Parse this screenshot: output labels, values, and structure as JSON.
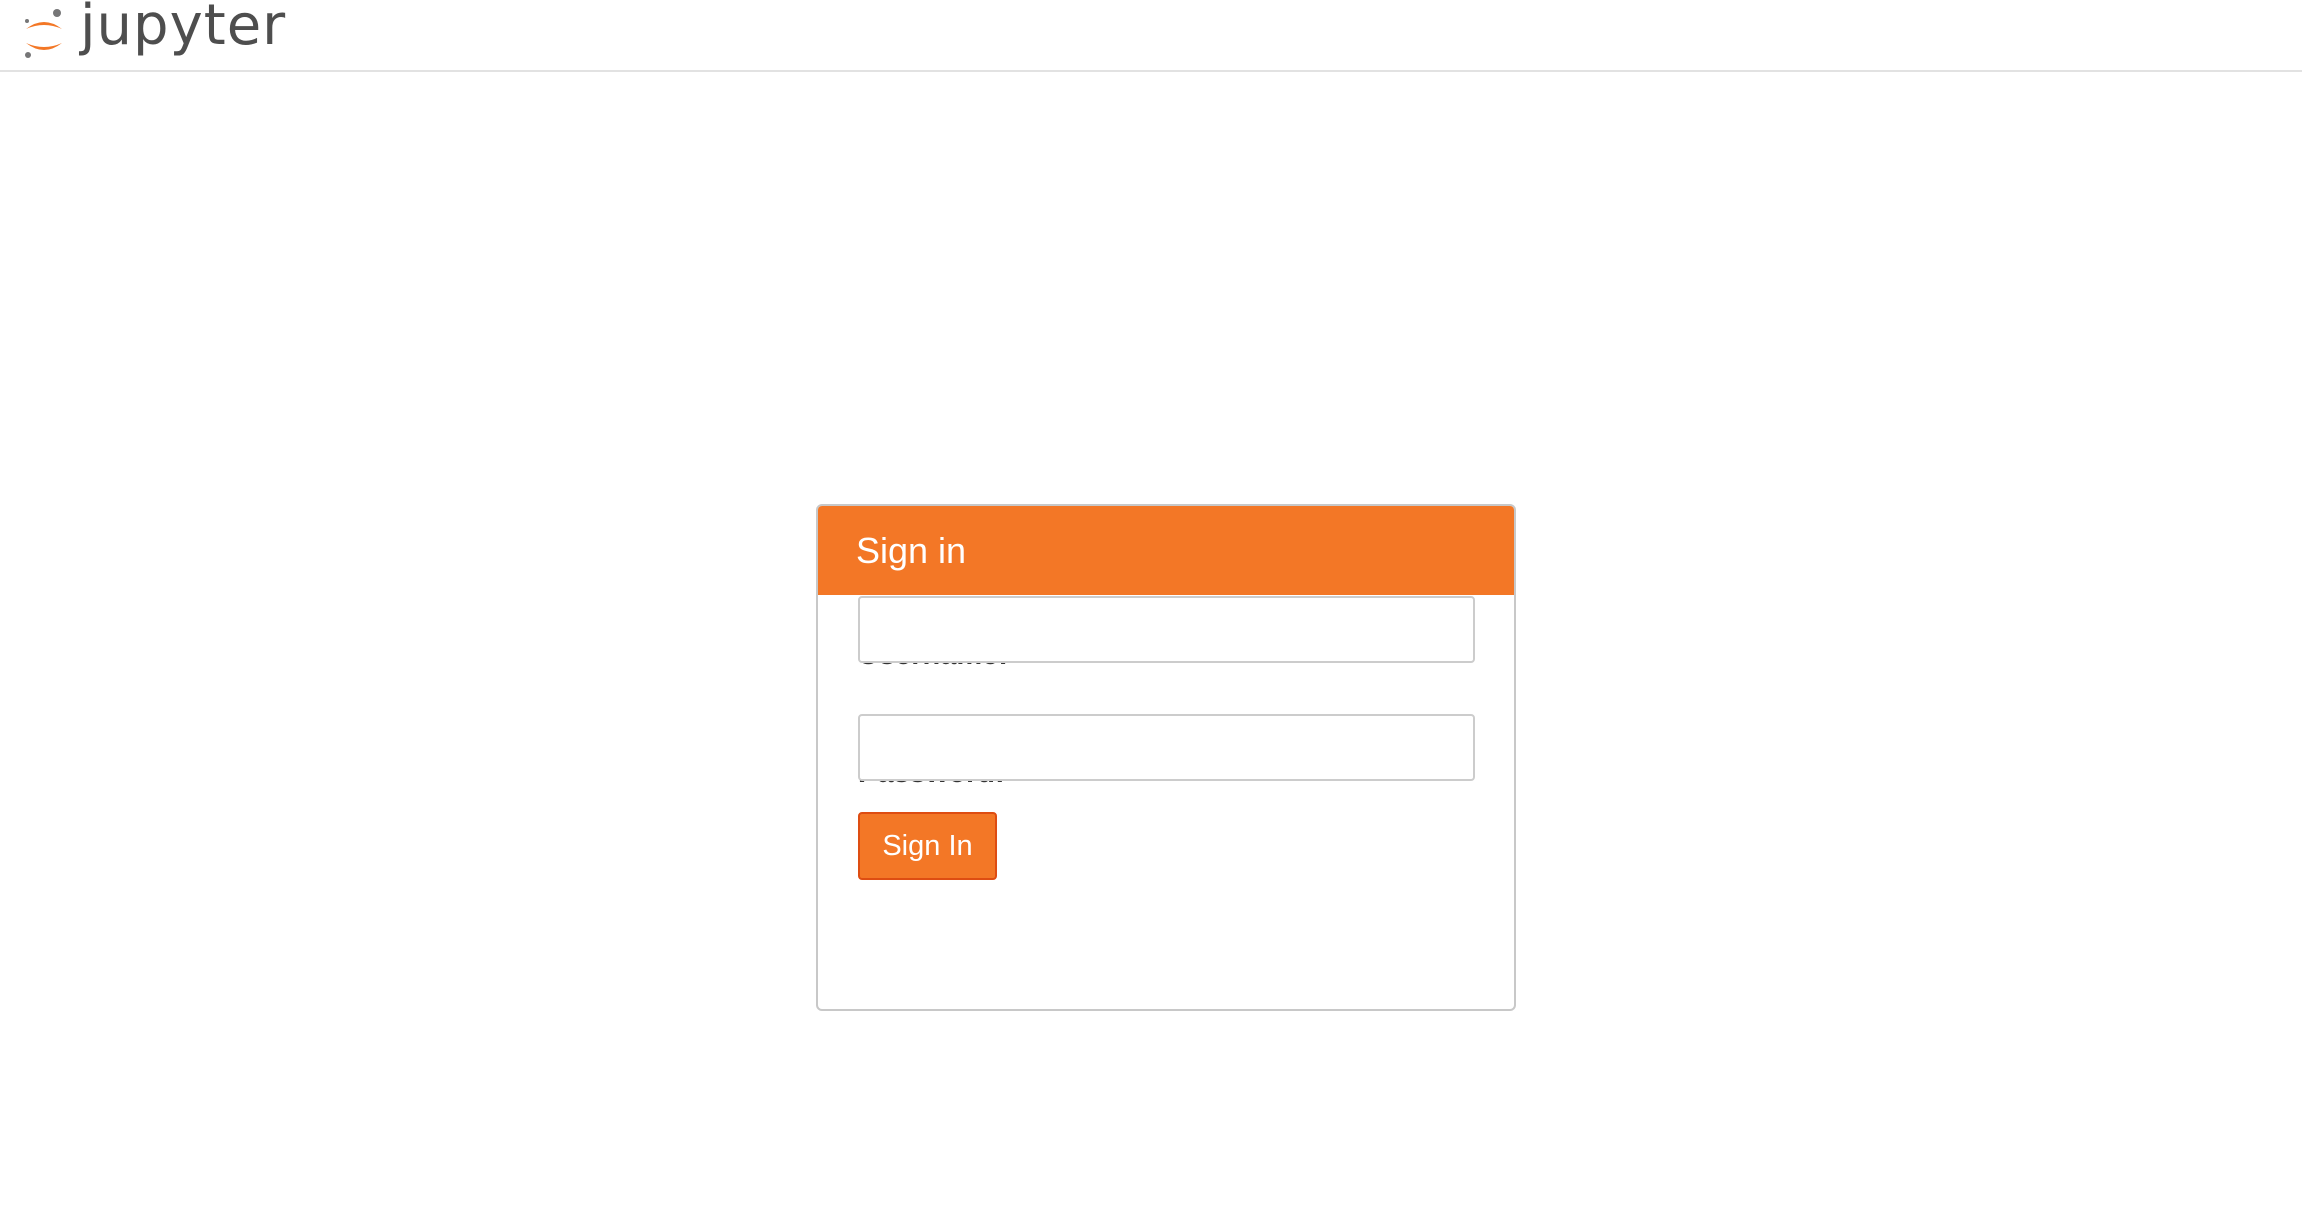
{
  "header": {
    "logo_text": "jupyter",
    "logo_icon": "jupyter-logo-icon"
  },
  "login": {
    "title": "Sign in",
    "username_label": "Username:",
    "username_value": "",
    "password_label": "Password:",
    "password_value": "",
    "submit_label": "Sign In"
  },
  "colors": {
    "brand_orange": "#f37726",
    "button_border": "#de4d12",
    "text": "#333333",
    "logo_text": "#4e4e4e",
    "logo_dots": "#767677"
  }
}
